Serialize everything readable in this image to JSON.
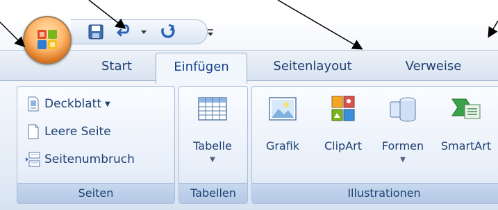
{
  "app": {
    "office_button": {
      "icon": "office-logo-icon"
    },
    "quick_access": [
      {
        "name": "save",
        "icon": "save-icon"
      },
      {
        "name": "undo",
        "icon": "undo-icon"
      },
      {
        "name": "undo-dropdown",
        "icon": "chevron-down-icon"
      },
      {
        "name": "redo",
        "icon": "redo-icon"
      },
      {
        "name": "customize",
        "icon": "customize-icon"
      }
    ]
  },
  "tabs": [
    {
      "label": "Start",
      "active": false
    },
    {
      "label": "Einfügen",
      "active": true
    },
    {
      "label": "Seitenlayout",
      "active": false
    },
    {
      "label": "Verweise",
      "active": false
    }
  ],
  "groups": {
    "seiten": {
      "caption": "Seiten",
      "buttons": [
        {
          "label": "Deckblatt",
          "icon": "cover-page-icon",
          "has_dropdown": true
        },
        {
          "label": "Leere Seite",
          "icon": "blank-page-icon"
        },
        {
          "label": "Seitenumbruch",
          "icon": "page-break-icon"
        }
      ]
    },
    "tabellen": {
      "caption": "Tabellen",
      "buttons": [
        {
          "label": "Tabelle",
          "icon": "table-icon",
          "has_dropdown": true
        }
      ]
    },
    "illustrationen": {
      "caption": "Illustrationen",
      "buttons": [
        {
          "label": "Grafik",
          "icon": "picture-icon"
        },
        {
          "label": "ClipArt",
          "icon": "clipart-icon"
        },
        {
          "label": "Formen",
          "icon": "shapes-icon",
          "has_dropdown": true
        },
        {
          "label": "SmartArt",
          "icon": "smartart-icon"
        }
      ]
    }
  },
  "colors": {
    "ribbon_text": "#15428b",
    "caption_bg": "#c7d8ee",
    "office_orange": "#ffb66b"
  }
}
